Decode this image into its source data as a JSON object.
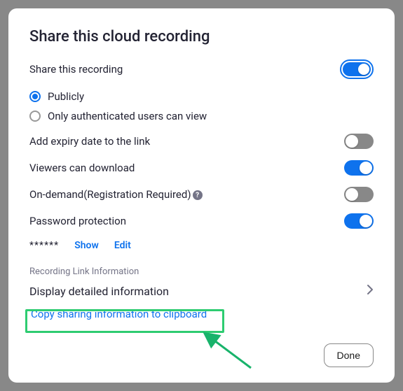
{
  "title": "Share this cloud recording",
  "shareThisRecording": {
    "label": "Share this recording",
    "publiclyLabel": "Publicly",
    "authLabel": "Only authenticated users can view"
  },
  "options": {
    "expiry": "Add expiry date to the link",
    "download": "Viewers can download",
    "ondemand": "On-demand(Registration Required)",
    "password": "Password protection"
  },
  "password": {
    "masked": "******",
    "show": "Show",
    "edit": "Edit"
  },
  "linkSection": {
    "header": "Recording Link Information",
    "detail": "Display detailed information",
    "copy": "Copy sharing information to clipboard"
  },
  "doneLabel": "Done",
  "helpGlyph": "?"
}
